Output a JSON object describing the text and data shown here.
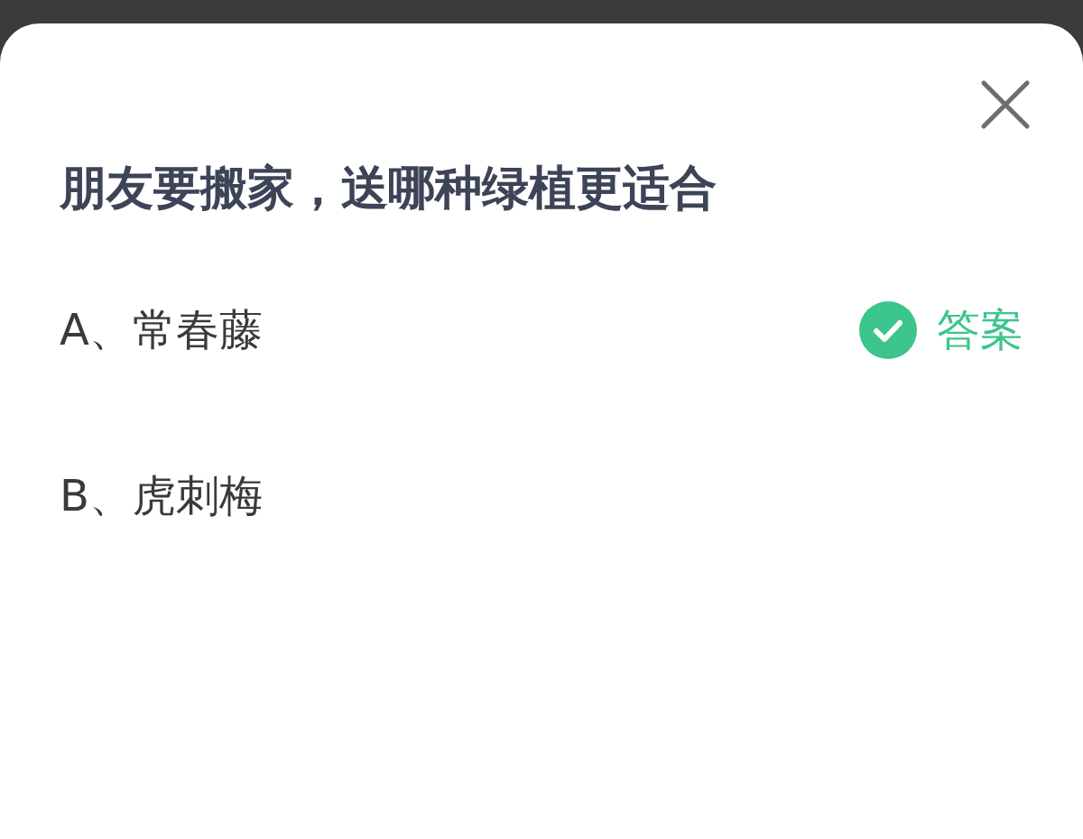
{
  "question": {
    "title": "朋友要搬家，送哪种绿植更适合"
  },
  "options": [
    {
      "label": "A、常春藤",
      "correct": true,
      "answer_label": "答案"
    },
    {
      "label": "B、虎刺梅",
      "correct": false
    }
  ]
}
